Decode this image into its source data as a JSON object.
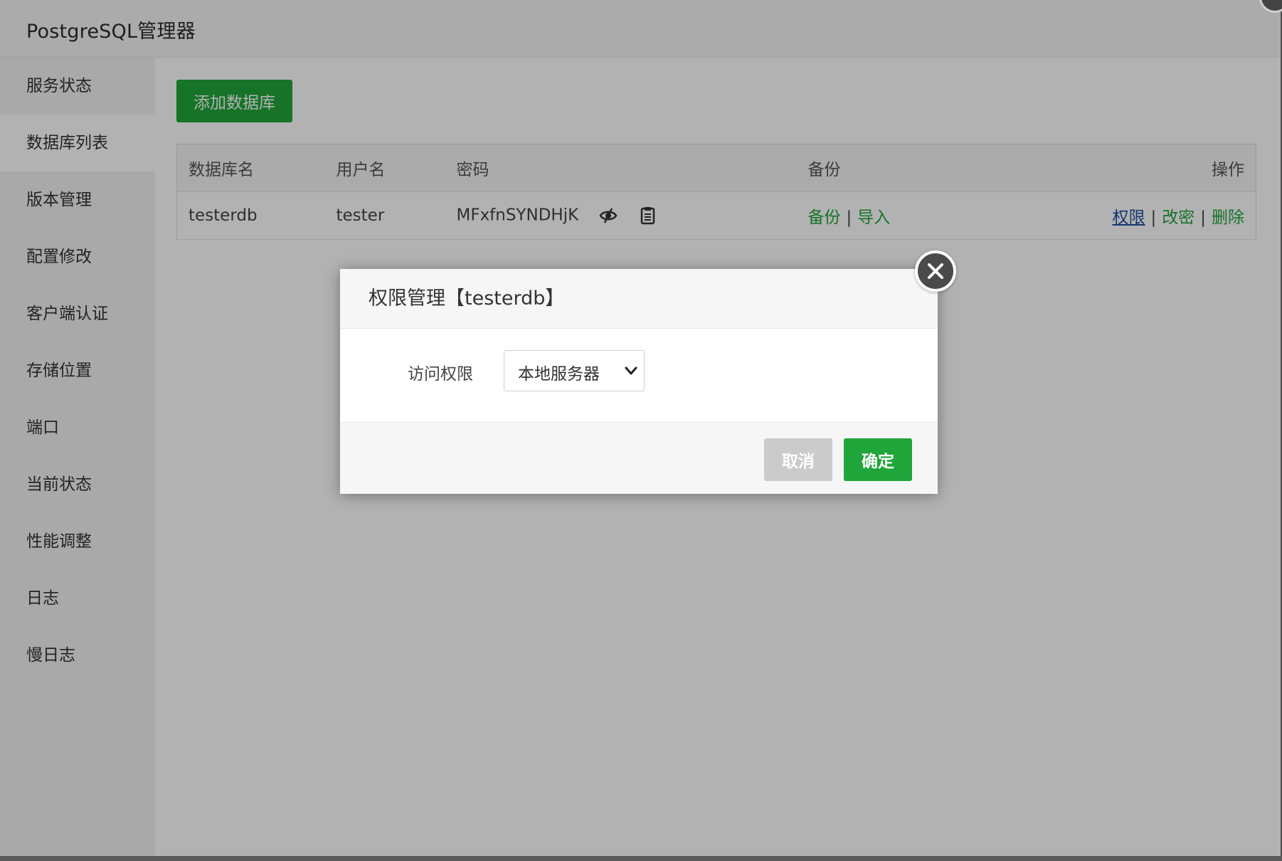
{
  "window": {
    "title": "PostgreSQL管理器"
  },
  "sidebar": {
    "items": [
      {
        "label": "服务状态",
        "active": false
      },
      {
        "label": "数据库列表",
        "active": true
      },
      {
        "label": "版本管理",
        "active": false
      },
      {
        "label": "配置修改",
        "active": false
      },
      {
        "label": "客户端认证",
        "active": false
      },
      {
        "label": "存储位置",
        "active": false
      },
      {
        "label": "端口",
        "active": false
      },
      {
        "label": "当前状态",
        "active": false
      },
      {
        "label": "性能调整",
        "active": false
      },
      {
        "label": "日志",
        "active": false
      },
      {
        "label": "慢日志",
        "active": false
      }
    ]
  },
  "toolbar": {
    "add_label": "添加数据库"
  },
  "table": {
    "headers": {
      "name": "数据库名",
      "user": "用户名",
      "password": "密码",
      "backup": "备份",
      "ops": "操作"
    },
    "rows": [
      {
        "name": "testerdb",
        "user": "tester",
        "password": "MFxfnSYNDHjK",
        "backup_label": "备份",
        "import_label": "导入",
        "perm_label": "权限",
        "change_pw_label": "改密",
        "delete_label": "删除",
        "sep": "|"
      }
    ]
  },
  "dialog": {
    "title": "权限管理【testerdb】",
    "field_label": "访问权限",
    "select_value": "本地服务器",
    "cancel_label": "取消",
    "ok_label": "确定"
  },
  "colors": {
    "accent": "#20a53a",
    "link_blue": "#1e50a2",
    "cancel_gray": "#cbcbcb"
  },
  "icons": {
    "password_toggle": "eye-slash-icon",
    "copy": "clipboard-icon",
    "close": "close-icon",
    "select_arrow": "chevron-down-icon"
  }
}
